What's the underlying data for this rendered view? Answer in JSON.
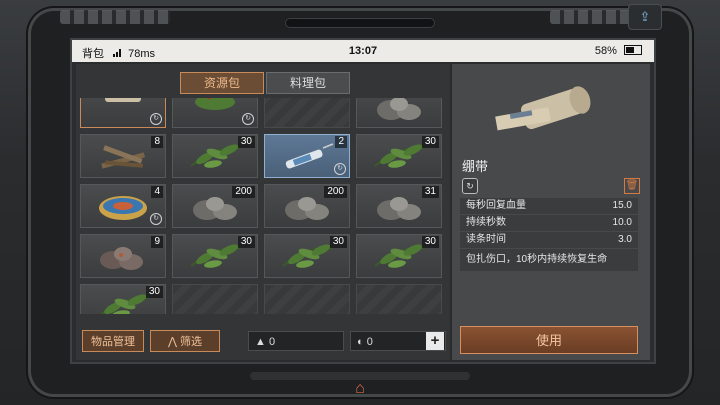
{
  "status": {
    "app": "背包",
    "ping": "78ms",
    "time": "13:07",
    "battery": "58%"
  },
  "tabs": [
    {
      "label": "资源包",
      "active": true
    },
    {
      "label": "料理包",
      "active": false
    }
  ],
  "grid": [
    [
      {
        "icon": "bandage-icon",
        "count": "",
        "recycle": true,
        "partial": true
      },
      {
        "icon": "berries-icon",
        "count": "",
        "recycle": true
      },
      {
        "icon": "empty",
        "count": ""
      },
      {
        "icon": "stone-icon",
        "count": ""
      }
    ],
    [
      {
        "icon": "wood-icon",
        "count": "8"
      },
      {
        "icon": "leaves-icon",
        "count": "30"
      },
      {
        "icon": "syringe-icon",
        "count": "2",
        "recycle": true,
        "selected": true
      },
      {
        "icon": "leaves-icon",
        "count": "30"
      }
    ],
    [
      {
        "icon": "canned-fish-icon",
        "count": "4",
        "recycle": true
      },
      {
        "icon": "stone-icon",
        "count": "200"
      },
      {
        "icon": "stone-icon",
        "count": "200"
      },
      {
        "icon": "stone-icon",
        "count": "31"
      }
    ],
    [
      {
        "icon": "ore-icon",
        "count": "9"
      },
      {
        "icon": "leaves-icon",
        "count": "30"
      },
      {
        "icon": "leaves-icon",
        "count": "30"
      },
      {
        "icon": "leaves-icon",
        "count": "30"
      }
    ],
    [
      {
        "icon": "leaves-icon",
        "count": "30"
      },
      {
        "icon": "empty",
        "count": ""
      },
      {
        "icon": "empty",
        "count": ""
      },
      {
        "icon": "empty",
        "count": ""
      }
    ]
  ],
  "bottom": {
    "manage": "物品管理",
    "filter": "筛选",
    "counter1": "0",
    "counter2": "0",
    "plus": "+"
  },
  "detail": {
    "name": "绷带",
    "stats": [
      {
        "label": "每秒回复血量",
        "value": "15.0"
      },
      {
        "label": "持续秒数",
        "value": "10.0"
      },
      {
        "label": "读条时间",
        "value": "3.0"
      }
    ],
    "description": "包扎伤口，10秒内持续恢复生命",
    "use": "使用"
  },
  "colors": {
    "accent": "#c88a58",
    "selected": "#5e7896"
  }
}
